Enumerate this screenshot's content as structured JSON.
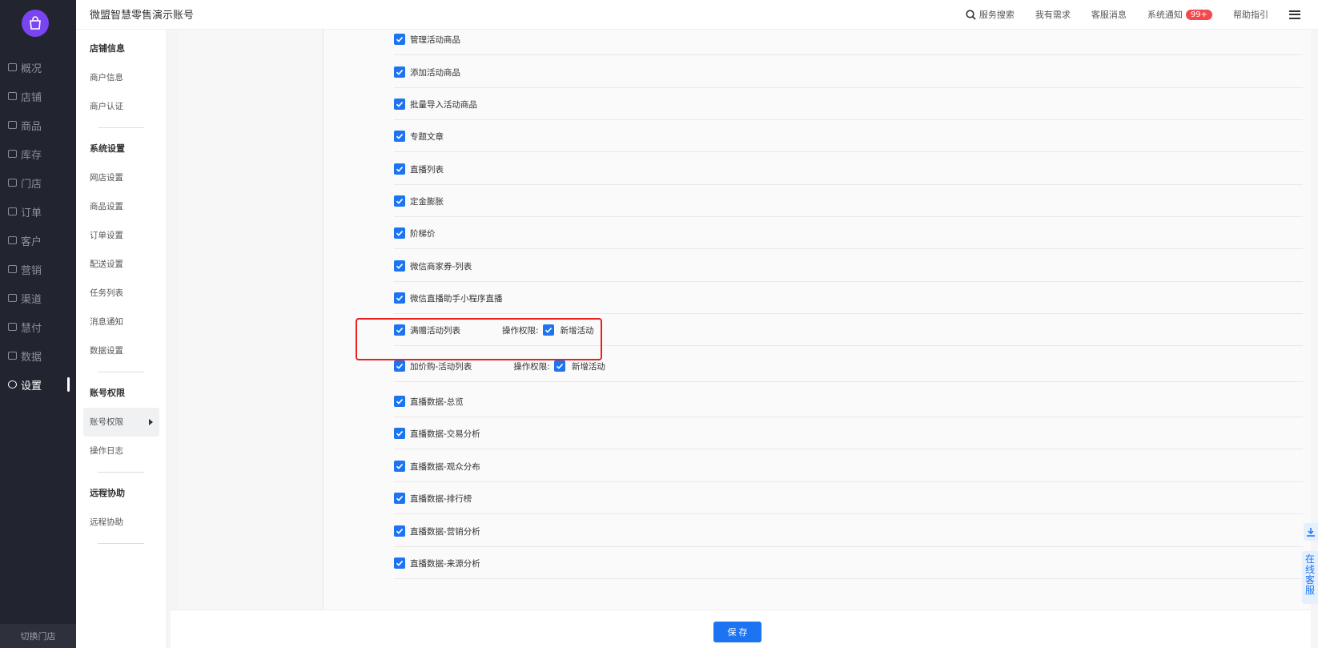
{
  "app": {
    "title": "微盟智慧零售演示账号"
  },
  "top_links": {
    "search": "服务搜索",
    "needs": "我有需求",
    "cs_msg": "客服消息",
    "notify": "系统通知",
    "notify_badge": "99+",
    "help": "帮助指引"
  },
  "nav": {
    "items": [
      "概况",
      "店铺",
      "商品",
      "库存",
      "门店",
      "订单",
      "客户",
      "营销",
      "渠道",
      "慧付",
      "数据",
      "设置"
    ],
    "active": "设置",
    "switch_store": "切换门店"
  },
  "subnav": {
    "shop_group": "店铺信息",
    "shop_items": [
      "商户信息",
      "商户认证"
    ],
    "sys_group": "系统设置",
    "sys_items": [
      "网店设置",
      "商品设置",
      "订单设置",
      "配送设置",
      "任务列表",
      "消息通知",
      "数据设置"
    ],
    "acct_group": "账号权限",
    "acct_items": [
      "账号权限",
      "操作日志"
    ],
    "remote_group": "远程协助",
    "remote_items": [
      "远程协助"
    ]
  },
  "permissions": [
    {
      "label": "管理活动商品",
      "checked": true
    },
    {
      "label": "添加活动商品",
      "checked": true
    },
    {
      "label": "批量导入活动商品",
      "checked": true
    },
    {
      "label": "专题文章",
      "checked": true
    },
    {
      "label": "直播列表",
      "checked": true
    },
    {
      "label": "定金膨胀",
      "checked": true
    },
    {
      "label": "阶梯价",
      "checked": true
    },
    {
      "label": "微信商家券-列表",
      "checked": true
    },
    {
      "label": "微信直播助手小程序直播",
      "checked": true
    },
    {
      "label": "满赠活动列表",
      "checked": true,
      "op_label": "操作权限:",
      "op_item": "新增活动"
    },
    {
      "label": "加价购-活动列表",
      "checked": true,
      "op_label": "操作权限:",
      "op_item": "新增活动"
    },
    {
      "label": "直播数据-总览",
      "checked": true
    },
    {
      "label": "直播数据-交易分析",
      "checked": true
    },
    {
      "label": "直播数据-观众分布",
      "checked": true
    },
    {
      "label": "直播数据-排行榜",
      "checked": true
    },
    {
      "label": "直播数据-营销分析",
      "checked": true
    },
    {
      "label": "直播数据-来源分析",
      "checked": true
    }
  ],
  "save_label": "保 存",
  "online_cs": "在线客服",
  "colors": {
    "primary": "#1d74f2",
    "sidebar": "#222430",
    "logo": "#7a44f2",
    "highlight": "#e82020"
  }
}
